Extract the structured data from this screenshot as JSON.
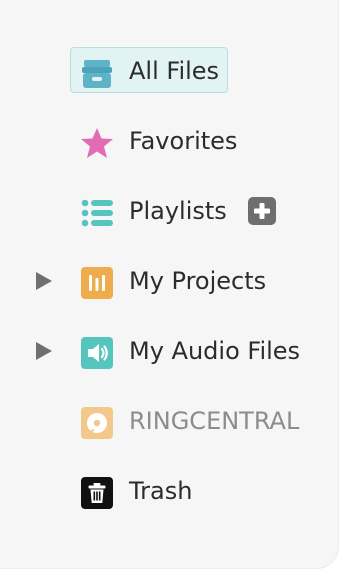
{
  "sidebar": {
    "items": [
      {
        "label": "All Files",
        "icon": "archive-box-icon",
        "selected": true
      },
      {
        "label": "Favorites",
        "icon": "star-icon"
      },
      {
        "label": "Playlists",
        "icon": "list-icon"
      },
      {
        "label": "My Projects",
        "icon": "project-folder-icon",
        "expandable": true
      },
      {
        "label": "My Audio Files",
        "icon": "speaker-icon",
        "expandable": true
      },
      {
        "label": "RINGCENTRAL",
        "icon": "disc-icon",
        "muted": true
      },
      {
        "label": "Trash",
        "icon": "trash-icon"
      }
    ]
  },
  "colors": {
    "selected_bg": "#e2f3f3",
    "teal": "#56c5be",
    "pink": "#e36ab4",
    "orange": "#efac4c",
    "peach": "#f2c98a",
    "muted_text": "#8c8c8c"
  }
}
